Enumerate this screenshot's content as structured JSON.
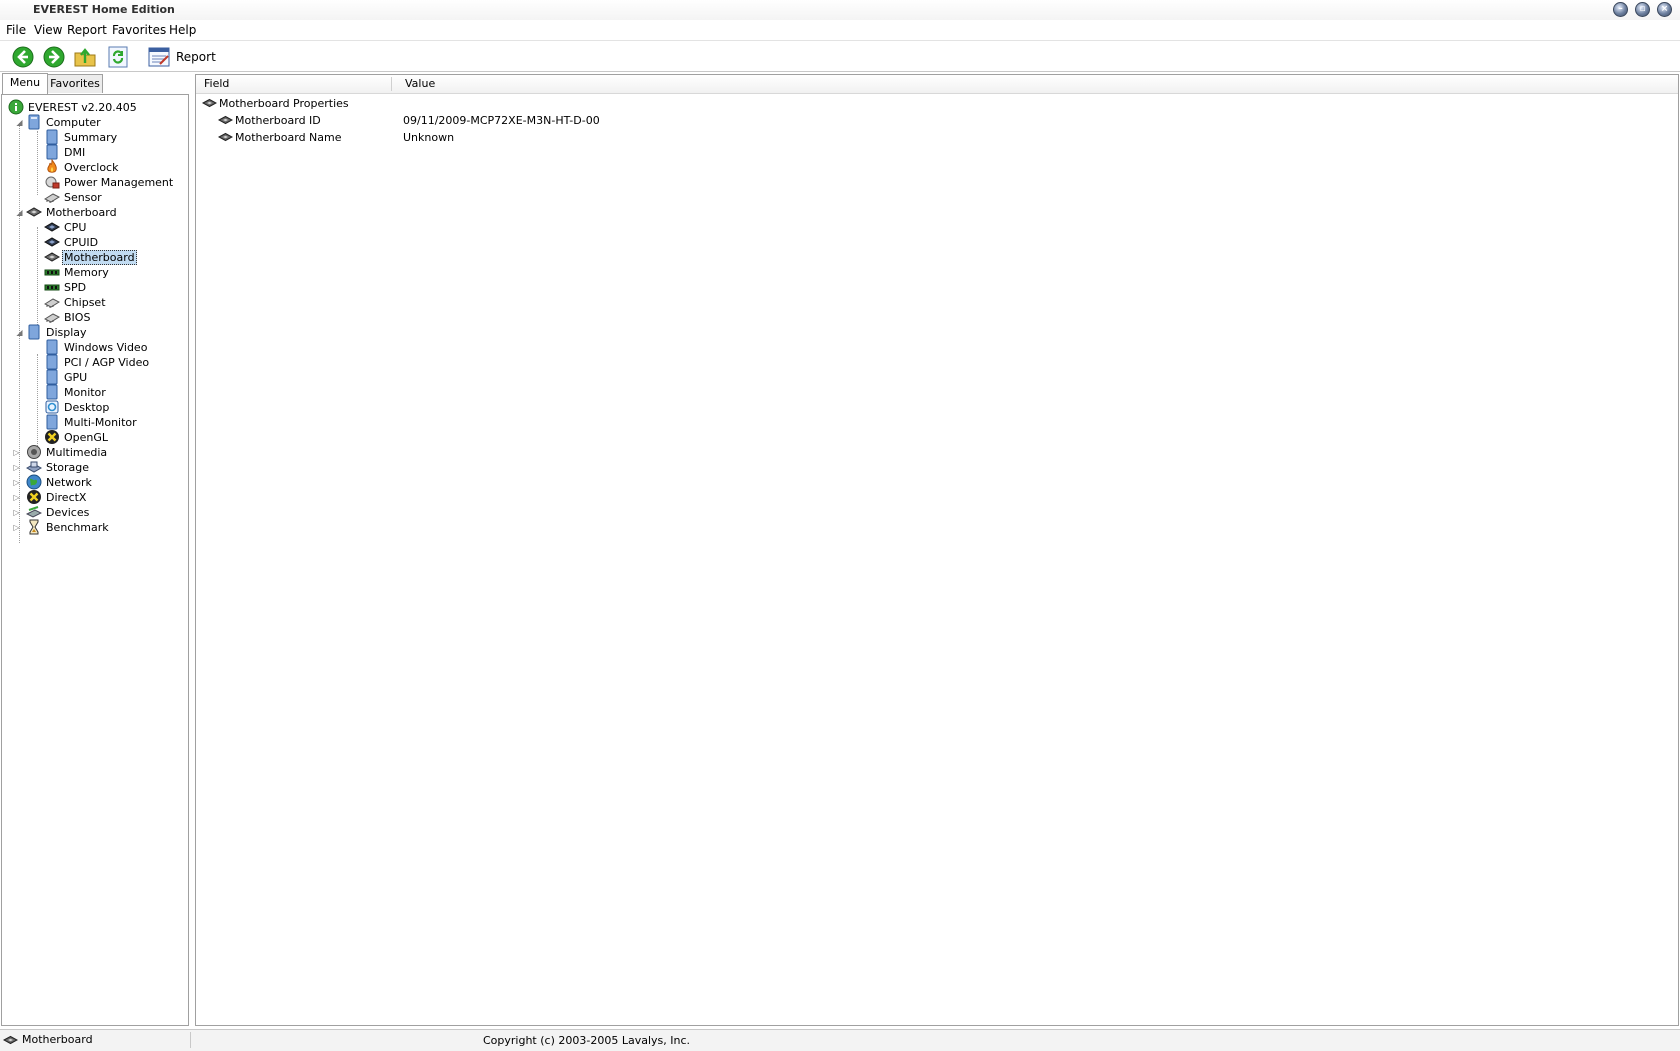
{
  "window": {
    "title": "EVEREST Home Edition"
  },
  "menubar": {
    "items": [
      "File",
      "View",
      "Report",
      "Favorites",
      "Help"
    ]
  },
  "toolbar": {
    "report_label": "Report"
  },
  "tabs": {
    "menu": "Menu",
    "favorites": "Favorites"
  },
  "tree": {
    "root": "EVEREST v2.20.405",
    "computer": {
      "label": "Computer",
      "children": [
        "Summary",
        "DMI",
        "Overclock",
        "Power Management",
        "Sensor"
      ]
    },
    "motherboard": {
      "label": "Motherboard",
      "children": [
        "CPU",
        "CPUID",
        "Motherboard",
        "Memory",
        "SPD",
        "Chipset",
        "BIOS"
      ],
      "selected": "Motherboard"
    },
    "display": {
      "label": "Display",
      "children": [
        "Windows Video",
        "PCI / AGP Video",
        "GPU",
        "Monitor",
        "Desktop",
        "Multi-Monitor",
        "OpenGL"
      ]
    },
    "collapsed": [
      "Multimedia",
      "Storage",
      "Network",
      "DirectX",
      "Devices",
      "Benchmark"
    ]
  },
  "details": {
    "columns": {
      "field": "Field",
      "value": "Value"
    },
    "group": "Motherboard Properties",
    "rows": [
      {
        "field": "Motherboard ID",
        "value": "09/11/2009-MCP72XE-M3N-HT-D-00"
      },
      {
        "field": "Motherboard Name",
        "value": "Unknown"
      }
    ]
  },
  "status": {
    "selection": "Motherboard",
    "copyright": "Copyright (c) 2003-2005 Lavalys, Inc."
  },
  "colors": {
    "selection": "#c2dcf2",
    "nav_green": "#2fa82f",
    "border": "#a0a0a0"
  }
}
